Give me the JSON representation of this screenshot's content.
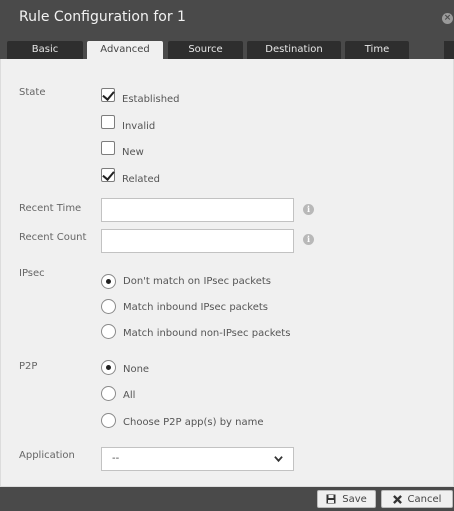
{
  "window": {
    "title": "Rule Configuration for 1",
    "close_glyph": "×"
  },
  "tabs": [
    {
      "label": "Basic",
      "active": false
    },
    {
      "label": "Advanced",
      "active": true
    },
    {
      "label": "Source",
      "active": false
    },
    {
      "label": "Destination",
      "active": false
    },
    {
      "label": "Time",
      "active": false
    }
  ],
  "state": {
    "label": "State",
    "options": [
      {
        "label": "Established",
        "checked": true
      },
      {
        "label": "Invalid",
        "checked": false
      },
      {
        "label": "New",
        "checked": false
      },
      {
        "label": "Related",
        "checked": true
      }
    ]
  },
  "recent_time": {
    "label": "Recent Time",
    "value": "",
    "info_glyph": "i"
  },
  "recent_count": {
    "label": "Recent Count",
    "value": "",
    "info_glyph": "i"
  },
  "ipsec": {
    "label": "IPsec",
    "options": [
      {
        "label": "Don't match on IPsec packets",
        "selected": true
      },
      {
        "label": "Match inbound IPsec packets",
        "selected": false
      },
      {
        "label": "Match inbound non-IPsec packets",
        "selected": false
      }
    ]
  },
  "p2p": {
    "label": "P2P",
    "options": [
      {
        "label": "None",
        "selected": true
      },
      {
        "label": "All",
        "selected": false
      },
      {
        "label": "Choose P2P app(s) by name",
        "selected": false
      }
    ]
  },
  "application": {
    "label": "Application",
    "selected_value": "--"
  },
  "footer": {
    "save_label": "Save",
    "cancel_label": "Cancel"
  },
  "icons": {
    "close": "close-icon",
    "info": "info-icon",
    "chevron": "chevron-down-icon",
    "save": "floppy-disk-icon",
    "cancel": "x-icon"
  },
  "colors": {
    "header_bg": "#4a4a4a",
    "tab_bg": "#2e2e2e",
    "active_tab_bg": "#f0f0f0",
    "content_bg": "#f0f0f0"
  }
}
